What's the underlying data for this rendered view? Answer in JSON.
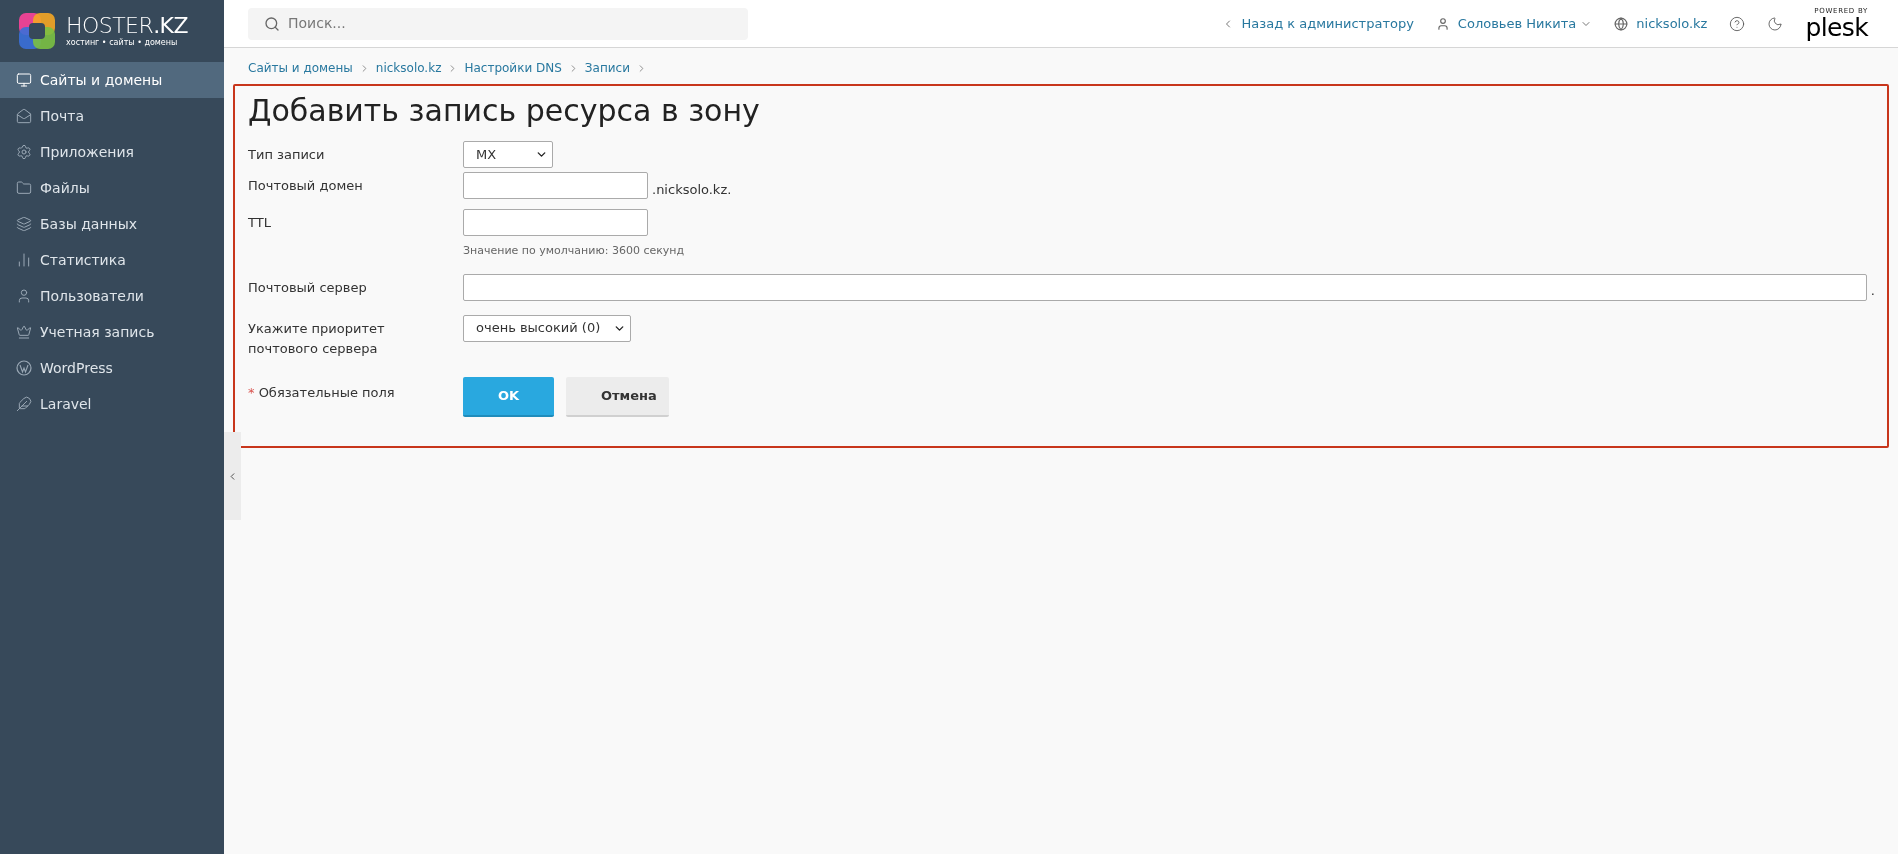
{
  "logo": {
    "name": "HOSTER**.KZ**",
    "tagline": "хостинг • сайты • домены"
  },
  "sidebar": {
    "items": [
      {
        "label": "Сайты и домены",
        "selected": true
      },
      {
        "label": "Почта",
        "selected": false
      },
      {
        "label": "Приложения",
        "selected": false
      },
      {
        "label": "Файлы",
        "selected": false
      },
      {
        "label": "Базы данных",
        "selected": false
      },
      {
        "label": "Статистика",
        "selected": false
      },
      {
        "label": "Пользователи",
        "selected": false
      },
      {
        "label": "Учетная запись",
        "selected": false
      },
      {
        "label": "WordPress",
        "selected": false
      },
      {
        "label": "Laravel",
        "selected": false
      }
    ]
  },
  "search": {
    "placeholder": "Поиск..."
  },
  "topbar": {
    "back": "Назад к администратору",
    "user": "Соловьев Никита",
    "domain": "nicksolo.kz",
    "powered_by": "POWERED BY",
    "brand": "plesk"
  },
  "breadcrumbs": [
    "Сайты и домены",
    "nicksolo.kz",
    "Настройки DNS",
    "Записи"
  ],
  "form": {
    "title": "Добавить запись ресурса в зону",
    "fields": [
      {
        "kind": "select",
        "label": "Тип записи",
        "value": "MX"
      },
      {
        "kind": "text",
        "label": "Почтовый домен",
        "suffix": ".nicksolo.kz."
      },
      {
        "kind": "text",
        "label": "TTL",
        "hint": "Значение по умолчанию: 3600 секунд"
      },
      {
        "kind": "text",
        "label": "Почтовый сервер",
        "suffix": "."
      },
      {
        "kind": "select",
        "label": "Укажите приоритет почтового сервера",
        "value": "очень высокий (0)"
      }
    ],
    "required_mark": "*",
    "required_note": "Обязательные поля",
    "buttons": [
      {
        "label": "OK",
        "kind": "primary"
      },
      {
        "label": "Отмена",
        "kind": "secondary"
      }
    ]
  }
}
